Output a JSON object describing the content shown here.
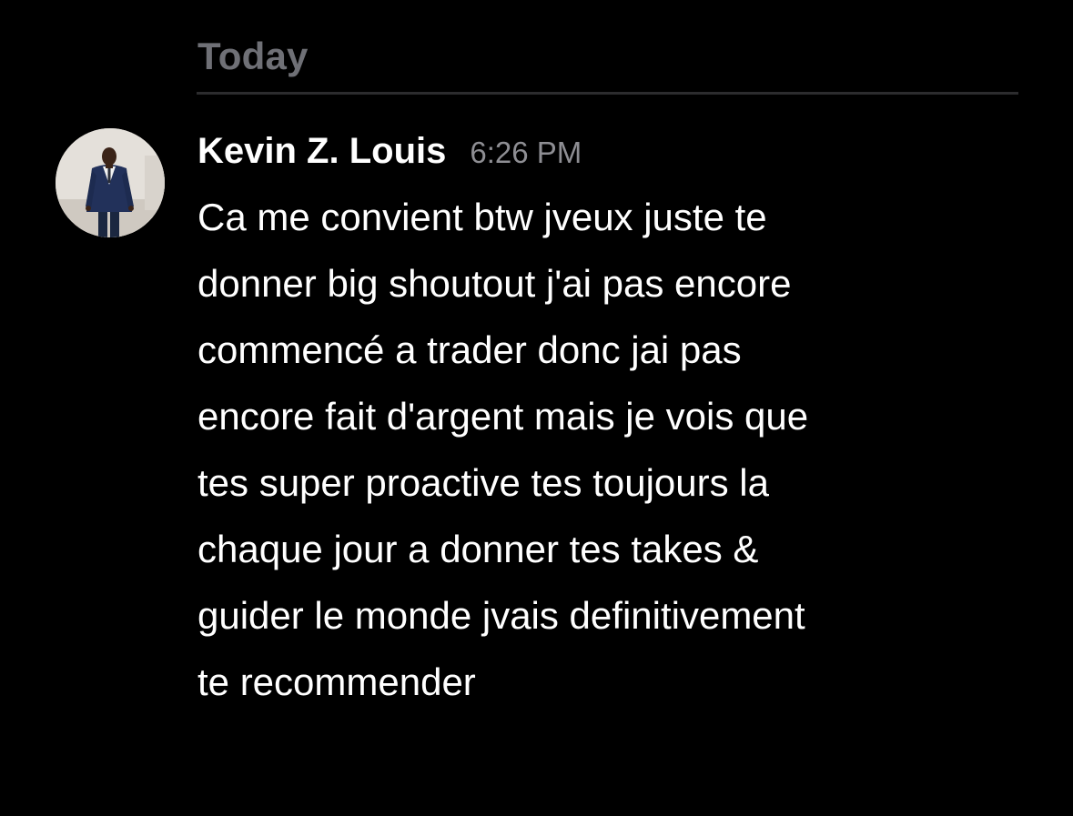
{
  "divider": {
    "label": "Today"
  },
  "message": {
    "author": "Kevin Z. Louis",
    "time": "6:26 PM",
    "avatar_icon": "person-photo-avatar",
    "lines": [
      "Ca me convient btw jveux juste te",
      "donner big shoutout j'ai pas encore",
      "commencé a trader donc jai pas",
      "encore fait d'argent mais je vois que",
      "tes super proactive tes toujours la",
      "chaque jour a donner tes takes &",
      "guider le monde jvais definitivement",
      "te recommender"
    ]
  },
  "colors": {
    "background": "#000000",
    "text": "#ffffff",
    "muted": "#8e8e93",
    "divider": "#2c2c2e"
  }
}
